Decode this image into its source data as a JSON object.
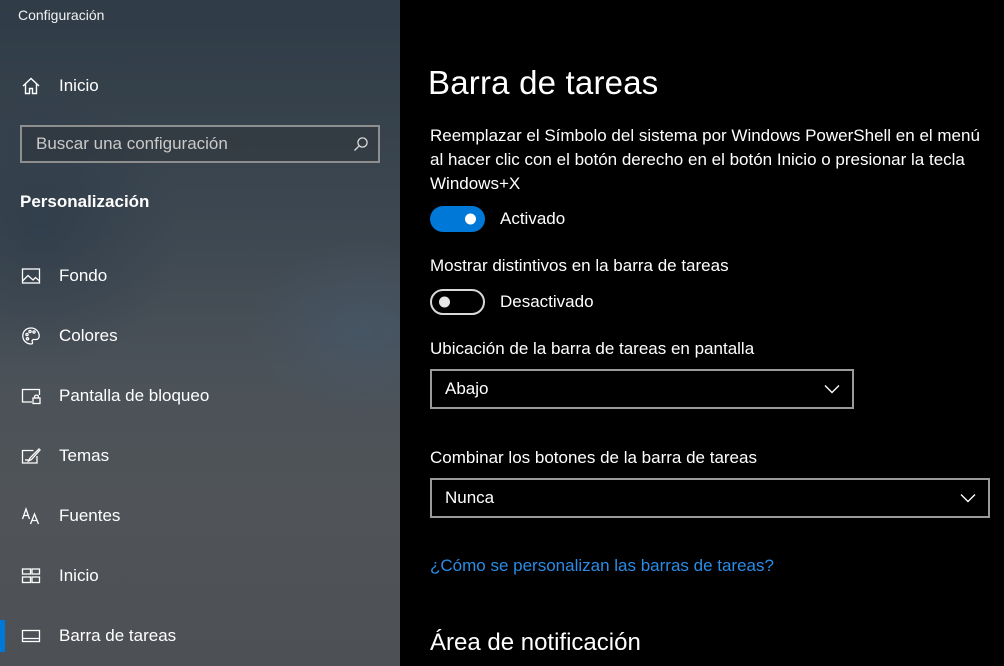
{
  "app": {
    "title": "Configuración"
  },
  "sidebar": {
    "home_label": "Inicio",
    "search": {
      "placeholder": "Buscar una configuración",
      "value": ""
    },
    "section_title": "Personalización",
    "items": [
      {
        "label": "Fondo",
        "icon": "picture-icon",
        "selected": false
      },
      {
        "label": "Colores",
        "icon": "palette-icon",
        "selected": false
      },
      {
        "label": "Pantalla de bloqueo",
        "icon": "lock-screen-icon",
        "selected": false
      },
      {
        "label": "Temas",
        "icon": "themes-icon",
        "selected": false
      },
      {
        "label": "Fuentes",
        "icon": "fonts-icon",
        "selected": false
      },
      {
        "label": "Inicio",
        "icon": "start-icon",
        "selected": false
      },
      {
        "label": "Barra de tareas",
        "icon": "taskbar-icon",
        "selected": true
      }
    ],
    "accent_color": "#0078d7"
  },
  "main": {
    "title": "Barra de tareas",
    "powershell": {
      "description": "Reemplazar el Símbolo del sistema por Windows PowerShell en el menú al hacer clic con el botón derecho en el botón Inicio o presionar la tecla Windows+X",
      "state_label": "Activado",
      "on": true
    },
    "badges": {
      "label": "Mostrar distintivos en la barra de tareas",
      "state_label": "Desactivado",
      "on": false
    },
    "location": {
      "label": "Ubicación de la barra de tareas en pantalla",
      "value": "Abajo"
    },
    "combine": {
      "label": "Combinar los botones de la barra de tareas",
      "value": "Nunca"
    },
    "help_link": "¿Cómo se personalizan las barras de tareas?",
    "notification_heading": "Área de notificación"
  }
}
